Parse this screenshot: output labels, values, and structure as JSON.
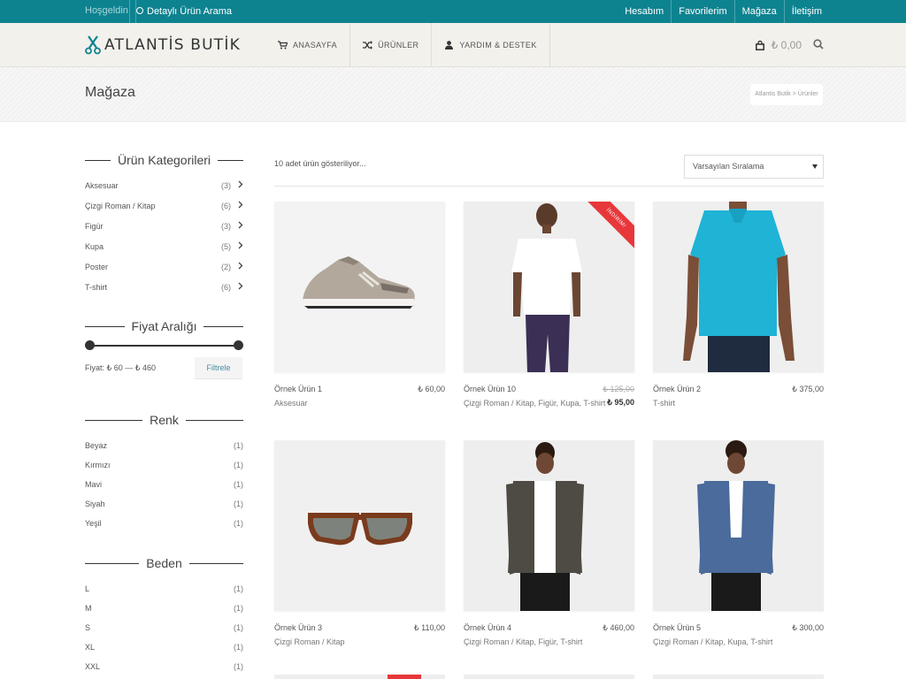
{
  "topbar": {
    "welcome": "Hoşgeldin",
    "detail_search": "Detaylı Ürün Arama",
    "links": [
      "Hesabım",
      "Favorilerim",
      "Mağaza",
      "İletişim"
    ]
  },
  "header": {
    "logo": "ATLANTİS BUTİK",
    "nav": [
      {
        "label": "ANASAYFA",
        "icon": "cart-icon"
      },
      {
        "label": "ÜRÜNLER",
        "icon": "shuffle-icon"
      },
      {
        "label": "YARDIM & DESTEK",
        "icon": "user-icon"
      }
    ],
    "cart_total": "₺ 0,00"
  },
  "page": {
    "title": "Mağaza",
    "breadcrumb": "Atlantis Butik > Ürünler"
  },
  "sidebar": {
    "categories_title": "Ürün Kategorileri",
    "categories": [
      {
        "name": "Aksesuar",
        "count": "(3)"
      },
      {
        "name": "Çizgi Roman / Kitap",
        "count": "(6)"
      },
      {
        "name": "Figür",
        "count": "(3)"
      },
      {
        "name": "Kupa",
        "count": "(5)"
      },
      {
        "name": "Poster",
        "count": "(2)"
      },
      {
        "name": "T-shirt",
        "count": "(6)"
      }
    ],
    "price_title": "Fiyat Aralığı",
    "price_text": "Fiyat: ₺ 60 — ₺ 460",
    "price_min_fraction": 0,
    "price_max_fraction": 1,
    "filter_button": "Filtrele",
    "color_title": "Renk",
    "colors": [
      {
        "name": "Beyaz",
        "count": "(1)"
      },
      {
        "name": "Kırmızı",
        "count": "(1)"
      },
      {
        "name": "Mavi",
        "count": "(1)"
      },
      {
        "name": "Siyah",
        "count": "(1)"
      },
      {
        "name": "Yeşil",
        "count": "(1)"
      }
    ],
    "size_title": "Beden",
    "sizes": [
      {
        "name": "L",
        "count": "(1)"
      },
      {
        "name": "M",
        "count": "(1)"
      },
      {
        "name": "S",
        "count": "(1)"
      },
      {
        "name": "XL",
        "count": "(1)"
      },
      {
        "name": "XXL",
        "count": "(1)"
      }
    ]
  },
  "shop": {
    "result_count": "10 adet ürün gösteriliyor...",
    "sort_selected": "Varsayılan Sıralama",
    "sale_badge": "İNDİRİM!",
    "products": [
      {
        "name": "Örnek Ürün 1",
        "price": "₺ 60,00",
        "category": "Aksesuar",
        "image": "sneaker"
      },
      {
        "name": "Örnek Ürün 10",
        "old_price": "₺ 125,00",
        "price": "₺ 95,00",
        "category": "Çizgi Roman / Kitap, Figür, Kupa, T-shirt",
        "image": "man-white-tee",
        "sale": true
      },
      {
        "name": "Örnek Ürün 2",
        "price": "₺ 375,00",
        "category": "T-shirt",
        "image": "blue-polo"
      },
      {
        "name": "Örnek Ürün 3",
        "price": "₺ 110,00",
        "category": "Çizgi Roman / Kitap",
        "image": "sunglasses"
      },
      {
        "name": "Örnek Ürün 4",
        "price": "₺ 460,00",
        "category": "Çizgi Roman / Kitap, Figür, T-shirt",
        "image": "man-jacket"
      },
      {
        "name": "Örnek Ürün 5",
        "price": "₺ 300,00",
        "category": "Çizgi Roman / Kitap, Kupa, T-shirt",
        "image": "man-blazer"
      }
    ]
  },
  "colors": {
    "topbar": "#0e8390",
    "header_bg": "#f2f1ec",
    "sale_red": "#e8373a",
    "polo_blue": "#1fb3d6"
  }
}
